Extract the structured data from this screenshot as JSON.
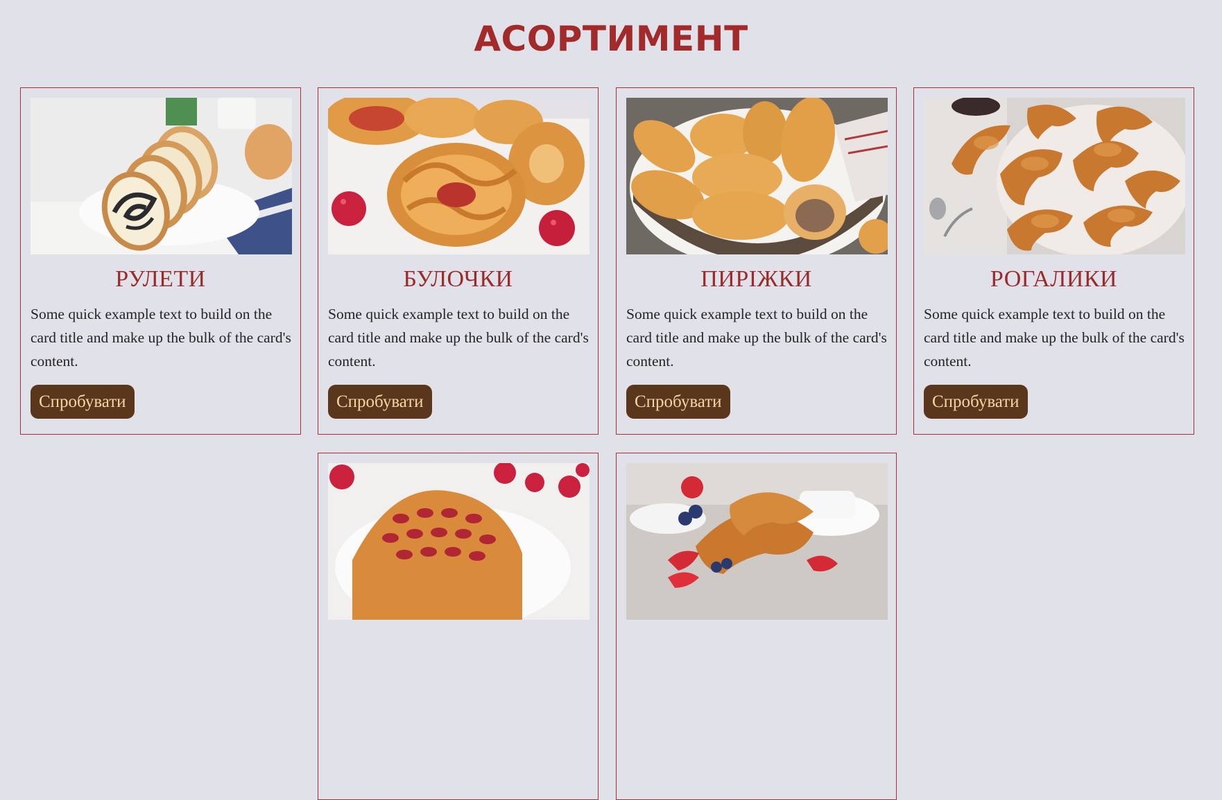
{
  "section": {
    "title": "АСОРТИМЕНТ"
  },
  "cards": [
    {
      "title": "РУЛЕТИ",
      "text": "Some quick example text to build on the card title and make up the bulk of the card's content.",
      "button": "Спробувати",
      "image": "poppy-seed-roll-photo"
    },
    {
      "title": "БУЛОЧКИ",
      "text": "Some quick example text to build on the card title and make up the bulk of the card's content.",
      "button": "Спробувати",
      "image": "sweet-buns-photo"
    },
    {
      "title": "ПИРІЖКИ",
      "text": "Some quick example text to build on the card title and make up the bulk of the card's content.",
      "button": "Спробувати",
      "image": "pies-basket-photo"
    },
    {
      "title": "РОГАЛИКИ",
      "text": "Some quick example text to build on the card title and make up the bulk of the card's content.",
      "button": "Спробувати",
      "image": "crescent-rolls-photo"
    },
    {
      "image": "lattice-pastry-photo"
    },
    {
      "image": "croissants-berries-photo"
    }
  ],
  "colors": {
    "background": "#e1e1e9",
    "accent": "#a12a2a",
    "button_bg": "#5a361c",
    "button_text": "#f3d6a4"
  }
}
